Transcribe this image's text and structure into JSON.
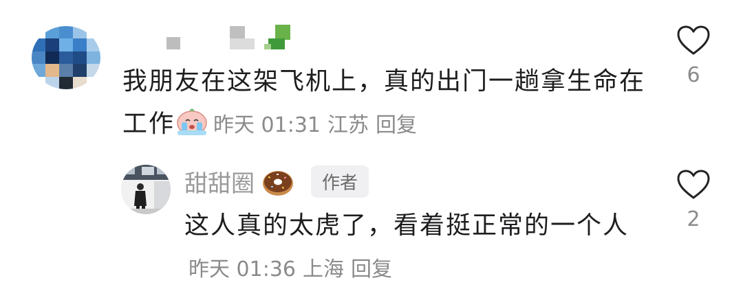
{
  "comment": {
    "text": "我朋友在这架飞机上，真的出门一趟拿生命在工作",
    "emoji": "crying-face-emoji",
    "time": "昨天 01:31",
    "location": "江苏",
    "reply_label": "回复",
    "likes": "6"
  },
  "reply": {
    "username": "甜甜圈",
    "name_emoji": "donut-emoji",
    "author_badge": "作者",
    "text": "这人真的太虎了，看着挺正常的一个人",
    "time": "昨天 01:36",
    "location": "上海",
    "reply_label": "回复",
    "likes": "2"
  },
  "colors": {
    "text": "#1d1d1f",
    "meta": "#8a8a8a",
    "username": "#9a9a9a",
    "badge_bg": "#f0f0f2",
    "heart_stroke": "#222222"
  }
}
